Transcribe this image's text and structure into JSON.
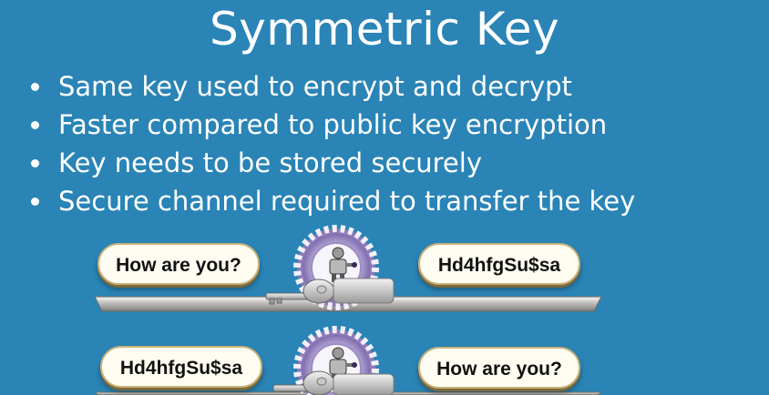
{
  "slide": {
    "title": "Symmetric Key",
    "bullets": [
      "Same key used to encrypt and decrypt",
      "Faster compared to public key encryption",
      "Key needs to be stored securely",
      "Secure channel required to transfer the key"
    ]
  },
  "diagram": {
    "encrypt_row": {
      "input": "How are you?",
      "output": "Hd4hfgSu$sa"
    },
    "decrypt_row": {
      "input": "Hd4hfgSu$sa",
      "output": "How are you?"
    }
  },
  "colors": {
    "background": "#2a84b6",
    "text": "#ffffff",
    "pill_fill": "#fffdf2",
    "gear": "#8e7bb8"
  }
}
